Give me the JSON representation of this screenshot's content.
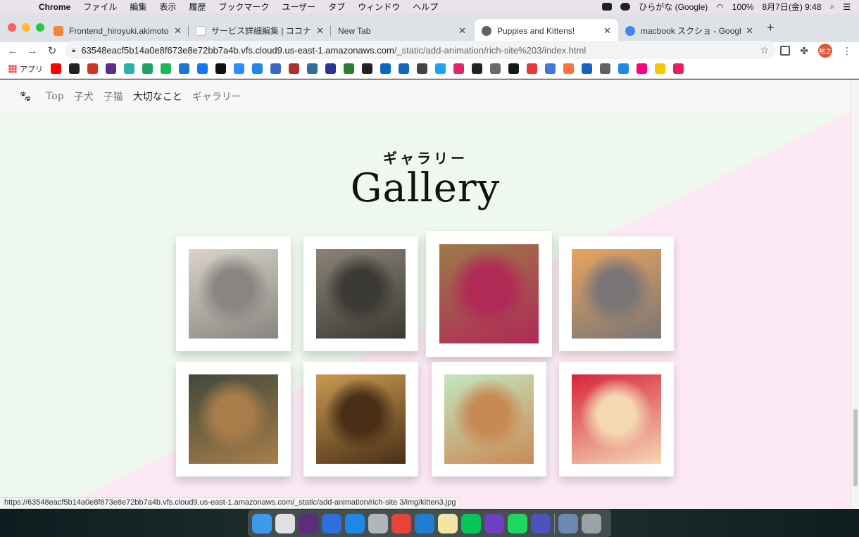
{
  "menubar": {
    "app_name": "Chrome",
    "items": [
      "ファイル",
      "編集",
      "表示",
      "履歴",
      "ブックマーク",
      "ユーザー",
      "タブ",
      "ウィンドウ",
      "ヘルプ"
    ],
    "input_method": "ひらがな (Google)",
    "battery": "100%",
    "datetime": "8月7日(金)  9:48"
  },
  "tabs": [
    {
      "title": "Frontend_hiroyuki.akimoto - AW",
      "favicon_color": "#f58536",
      "active": false
    },
    {
      "title": "サービス詳細編集 | ココナラ",
      "favicon_color": "#ffffff",
      "active": false
    },
    {
      "title": "New Tab",
      "favicon_color": "",
      "active": false
    },
    {
      "title": "Puppies and Kittens!",
      "favicon_color": "#5f6368",
      "active": true
    },
    {
      "title": "macbook スクショ - Google 検索",
      "favicon_color": "#4285f4",
      "active": false
    }
  ],
  "address_bar": {
    "host": "63548eacf5b14a0e8f673e8e72bb7a4b.vfs.cloud9.us-east-1.amazonaws.com",
    "path": "/_static/add-animation/rich-site%203/index.html"
  },
  "profile_initials": "裕之",
  "bookmarks": {
    "apps_label": "アプリ",
    "icon_colors": [
      "#ff0000",
      "#222222",
      "#d93025",
      "#5c2d91",
      "#2bb3a8",
      "#1fa463",
      "#1bb55c",
      "#1976d2",
      "#1877f2",
      "#111111",
      "#2d8cff",
      "#1e88e5",
      "#3a66c4",
      "#a83232",
      "#2f6f9f",
      "#283593",
      "#2e7d32",
      "#222222",
      "#0a66c2",
      "#1565c0",
      "#444444",
      "#1da1f2",
      "#e2246b",
      "#222222",
      "#6a6a6a",
      "#181717",
      "#e53935",
      "#3f7bd6",
      "#ff7043",
      "#1565c0",
      "#5f6368",
      "#1e88e5",
      "#ff0084",
      "#f7c600",
      "#e91e63"
    ]
  },
  "site": {
    "nav": [
      "Top",
      "子犬",
      "子猫",
      "大切なこと",
      "ギャラリー"
    ],
    "nav_active_index": 3,
    "subtitle": "ギャラリー",
    "title": "Gallery",
    "gallery": [
      {
        "subject": "gray tabby kitten",
        "colors": [
          "#d9d3cc",
          "#8a8580"
        ]
      },
      {
        "subject": "fluffy gray cat yawning",
        "colors": [
          "#8b8377",
          "#3c3a34"
        ]
      },
      {
        "subject": "bengal cat on pink blanket",
        "colors": [
          "#9c7a4a",
          "#b02a56"
        ]
      },
      {
        "subject": "gray kitten lying on orange",
        "colors": [
          "#e8a35f",
          "#7a7676"
        ]
      },
      {
        "subject": "german shepherd",
        "colors": [
          "#3f4a3a",
          "#a87d4a"
        ]
      },
      {
        "subject": "golden retriever",
        "colors": [
          "#c99a52",
          "#4a2f17"
        ]
      },
      {
        "subject": "toy poodle in pink dress",
        "colors": [
          "#c4e6c0",
          "#c88a55"
        ]
      },
      {
        "subject": "pomeranian on red",
        "colors": [
          "#d8243a",
          "#f4d8b4"
        ]
      }
    ]
  },
  "status_url": "https://63548eacf5b14a0e8f673e8e72bb7a4b.vfs.cloud9.us-east-1.amazonaws.com/_static/add-animation/rich-site 3/img/kitten3.jpg",
  "dock": {
    "app_colors": [
      "#3b9be8",
      "#e0e0e0",
      "#5b2d7a",
      "#2f6fdc",
      "#1e88e5",
      "#b0b6bc",
      "#e8433b",
      "#1e7fd2",
      "#f2e6a6",
      "#06c755",
      "#6e3fbf",
      "#1ed760",
      "#4b53bc",
      "#6a88b0",
      "#9aa3a8"
    ]
  }
}
